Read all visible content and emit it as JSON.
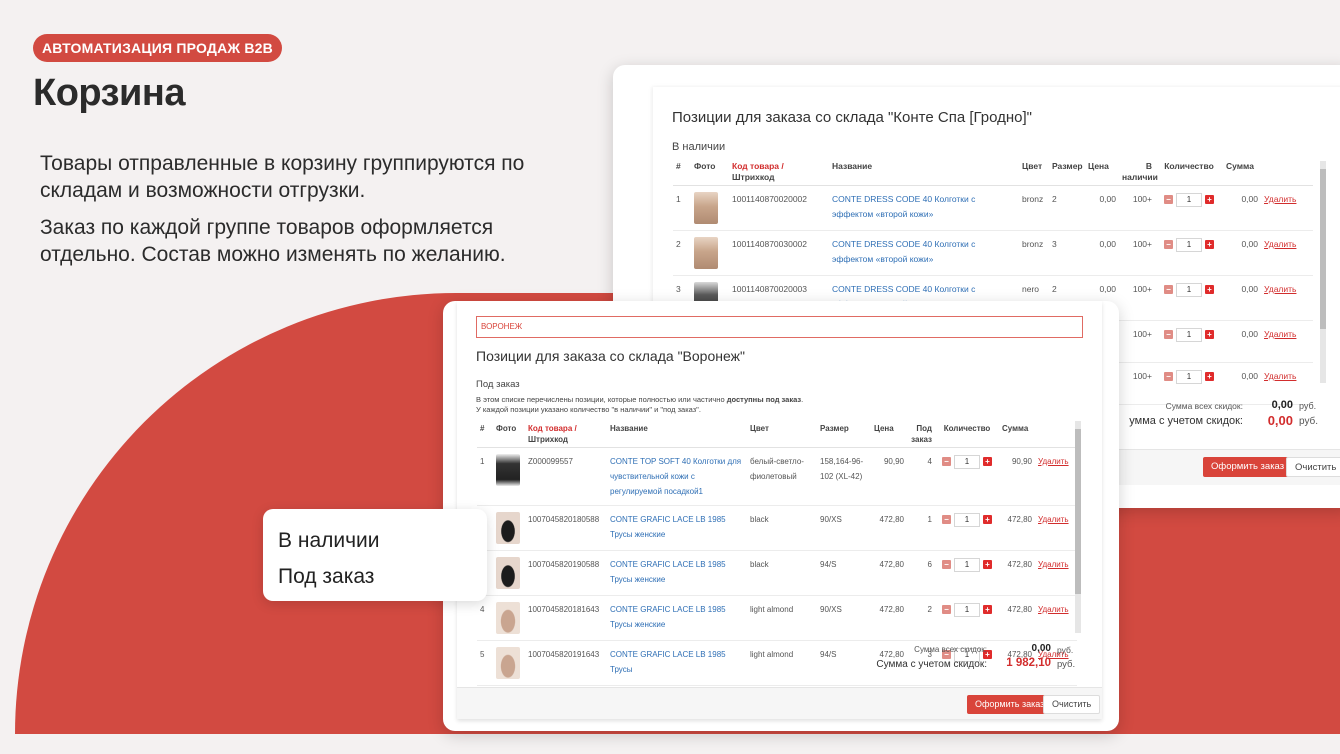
{
  "badge": "АВТОМАТИЗАЦИЯ ПРОДАЖ B2B",
  "title": "Корзина",
  "para1": "Товары отправленные в корзину группируются по складам и возможности отгрузки.",
  "para2": "Заказ по каждой группе товаров оформляется отдельно. Состав можно изменять по желанию.",
  "popup": {
    "in_stock": "В наличии",
    "on_order": "Под заказ"
  },
  "colors": {
    "accent": "#d24a41",
    "link": "#2f6fb5",
    "danger": "#d22d2d"
  },
  "grodno": {
    "title": "Позиции для заказа со склада \"Конте Спа [Гродно]\"",
    "group": "В наличии",
    "headers": {
      "num": "#",
      "photo": "Фото",
      "code": "Код товара /",
      "barcode": "Штрихкод",
      "name": "Название",
      "color": "Цвет",
      "size": "Размер",
      "price": "Цена",
      "stock1": "В",
      "stock2": "наличии",
      "qty": "Количество",
      "sum": "Сумма"
    },
    "rows": [
      {
        "n": "1",
        "code": "1001140870020002",
        "name": "CONTE DRESS CODE 40 Колготки с эффектом «второй кожи»",
        "color": "bronz",
        "size": "2",
        "price": "0,00",
        "stock": "100+",
        "qty": "1",
        "sum": "0,00",
        "del": "Удалить",
        "photo": "tan"
      },
      {
        "n": "2",
        "code": "1001140870030002",
        "name": "CONTE DRESS CODE 40 Колготки с эффектом «второй кожи»",
        "color": "bronz",
        "size": "3",
        "price": "0,00",
        "stock": "100+",
        "qty": "1",
        "sum": "0,00",
        "del": "Удалить",
        "photo": "tan"
      },
      {
        "n": "3",
        "code": "1001140870020003",
        "name": "CONTE DRESS CODE 40 Колготки с эффектом «второй кожи»",
        "color": "nero",
        "size": "2",
        "price": "0,00",
        "stock": "100+",
        "qty": "1",
        "sum": "0,00",
        "del": "Удалить",
        "photo": "dark"
      },
      {
        "n": "",
        "code": "",
        "name": "",
        "color": "",
        "size": "",
        "price": "",
        "stock": "100+",
        "qty": "1",
        "sum": "0,00",
        "del": "Удалить",
        "photo": "none"
      },
      {
        "n": "",
        "code": "",
        "name": "",
        "color": "",
        "size": "",
        "price": "",
        "stock": "100+",
        "qty": "1",
        "sum": "0,00",
        "del": "Удалить",
        "photo": "none"
      }
    ],
    "sum_discount_label": "Сумма всех скидок:",
    "sum_discount": "0,00",
    "sum_total_label": "умма с учетом скидок:",
    "sum_total": "0,00",
    "currency": "руб.",
    "order_btn": "Оформить заказ",
    "clear_btn": "Очистить"
  },
  "voronezh": {
    "search_value": "ВОРОНЕЖ",
    "title": "Позиции для заказа со склада \"Воронеж\"",
    "group": "Под заказ",
    "note1a": "В этом списке перечислены позиции, которые полностью или частично ",
    "note1b": "доступны под заказ",
    "note1c": ".",
    "note2": "У каждой позиции указано количество \"в наличии\" и \"под заказ\".",
    "headers": {
      "num": "#",
      "photo": "Фото",
      "code": "Код товара /",
      "barcode": "Штрихкод",
      "name": "Название",
      "color": "Цвет",
      "size": "Размер",
      "price": "Цена",
      "order1": "Под",
      "order2": "заказ",
      "qty": "Количество",
      "sum": "Сумма"
    },
    "rows": [
      {
        "n": "1",
        "code": "Z000099557",
        "name": "CONTE TOP SOFT 40 Колготки для чувствительной кожи с регулируемой посадкой1",
        "color": "белый-светло-фиолетовый",
        "size": "158,164-96-102 (XL-42)",
        "price": "90,90",
        "order": "4",
        "qty": "1",
        "sum": "90,90",
        "del": "Удалить",
        "photo": "shirt"
      },
      {
        "n": "2",
        "code": "1007045820180588",
        "name": "CONTE GRAFIC LACE LB 1985 Трусы женские",
        "color": "black",
        "size": "90/XS",
        "price": "472,80",
        "order": "1",
        "qty": "1",
        "sum": "472,80",
        "del": "Удалить",
        "photo": "brief"
      },
      {
        "n": "3",
        "code": "1007045820190588",
        "name": "CONTE GRAFIC LACE LB 1985 Трусы женские",
        "color": "black",
        "size": "94/S",
        "price": "472,80",
        "order": "6",
        "qty": "1",
        "sum": "472,80",
        "del": "Удалить",
        "photo": "brief"
      },
      {
        "n": "4",
        "code": "1007045820181643",
        "name": "CONTE GRAFIC LACE LB 1985 Трусы женские",
        "color": "light almond",
        "size": "90/XS",
        "price": "472,80",
        "order": "2",
        "qty": "1",
        "sum": "472,80",
        "del": "Удалить",
        "photo": "almond"
      },
      {
        "n": "5",
        "code": "1007045820191643",
        "name": "CONTE GRAFIC LACE LB 1985 Трусы",
        "color": "light almond",
        "size": "94/S",
        "price": "472,80",
        "order": "3",
        "qty": "1",
        "sum": "472,80",
        "del": "Удалить",
        "photo": "almond"
      }
    ],
    "sum_discount_label": "Сумма всех скидок:",
    "sum_discount": "0,00",
    "sum_total_label": "Сумма с учетом скидок:",
    "sum_total": "1 982,10",
    "currency": "руб.",
    "order_btn": "Оформить заказ",
    "clear_btn": "Очистить"
  }
}
